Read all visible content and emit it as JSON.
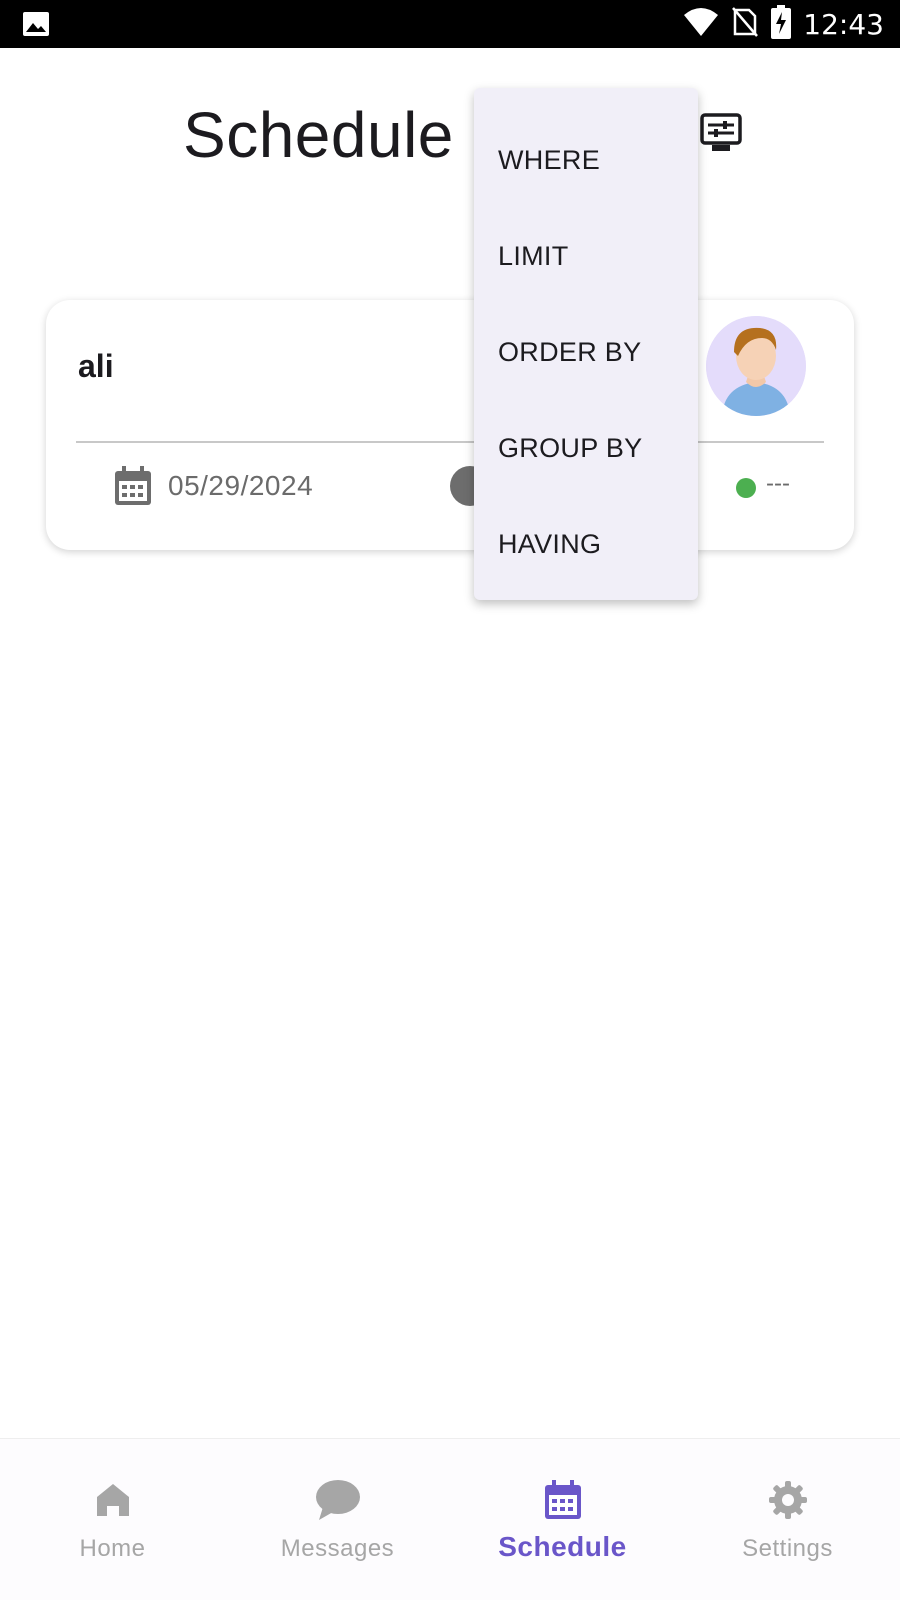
{
  "status_bar": {
    "time": "12:43"
  },
  "header": {
    "title": "Schedule"
  },
  "card": {
    "name": "ali",
    "date": "05/29/2024",
    "status": "---",
    "status_color": "#4caf50"
  },
  "menu": {
    "items": [
      {
        "label": "WHERE"
      },
      {
        "label": "LIMIT"
      },
      {
        "label": "ORDER BY"
      },
      {
        "label": "GROUP BY"
      },
      {
        "label": "HAVING"
      }
    ]
  },
  "bottom_nav": {
    "items": [
      {
        "label": "Home",
        "icon": "home-icon"
      },
      {
        "label": "Messages",
        "icon": "chat-bubble-icon"
      },
      {
        "label": "Schedule",
        "icon": "calendar-icon"
      },
      {
        "label": "Settings",
        "icon": "gear-icon"
      }
    ],
    "active": "Schedule",
    "accent": "#6a56c9"
  }
}
